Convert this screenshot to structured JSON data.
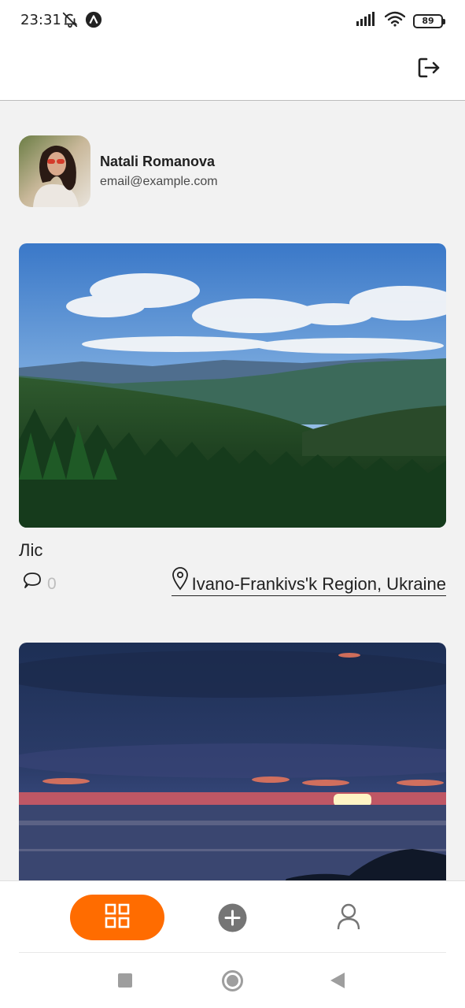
{
  "status_bar": {
    "time": "23:31",
    "battery": "89"
  },
  "header": {
    "logout_icon": "logout-icon"
  },
  "profile": {
    "name": "Natali Romanova",
    "email": "email@example.com"
  },
  "posts": [
    {
      "title": "Ліс",
      "comments": "0",
      "location": "Ivano-Frankivs'k Region, Ukraine"
    },
    {
      "title": "",
      "comments": "",
      "location": ""
    }
  ],
  "tab_bar": {
    "items": [
      {
        "icon": "grid-icon",
        "active": true
      },
      {
        "icon": "plus-circle-icon",
        "active": false
      },
      {
        "icon": "user-icon",
        "active": false
      }
    ],
    "accent": "#FF6C00"
  },
  "nav_bar": {
    "items": [
      "recents-square-icon",
      "home-circle-icon",
      "back-triangle-icon"
    ]
  }
}
